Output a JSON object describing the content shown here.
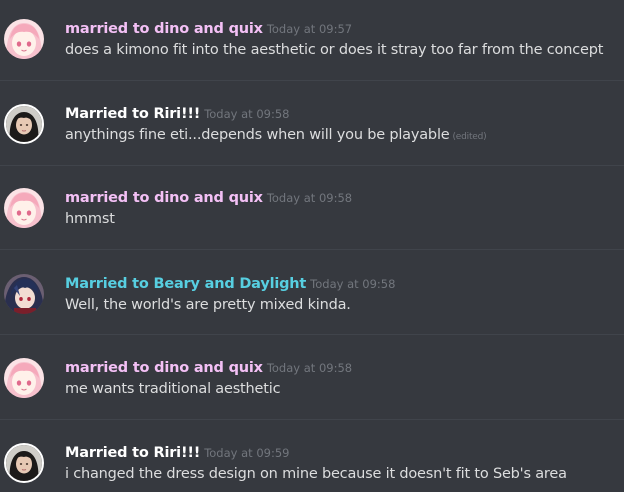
{
  "messages": [
    {
      "username": "married to dino and quix",
      "username_color": "#f3c0f5",
      "timestamp": "Today at 09:57",
      "text": "does a kimono fit into the aesthetic or does it stray too far from the concept",
      "avatar": "pink-hair-avatar"
    },
    {
      "username": "Married to Riri!!!",
      "username_color": "#ffffff",
      "timestamp": "Today at 09:58",
      "text": "anythings fine eti...depends when will you be playable",
      "edited": "(edited)",
      "avatar": "dark-hair-girl-avatar"
    },
    {
      "username": "married to dino and quix",
      "username_color": "#f3c0f5",
      "timestamp": "Today at 09:58",
      "text": "hmmst",
      "avatar": "pink-hair-avatar"
    },
    {
      "username": "Married to Beary and Daylight",
      "username_color": "#57cfe1",
      "timestamp": "Today at 09:58",
      "text": "Well, the world's are pretty mixed kinda.",
      "avatar": "blue-hair-character-avatar"
    },
    {
      "username": "married to dino and quix",
      "username_color": "#f3c0f5",
      "timestamp": "Today at 09:58",
      "text": "me wants traditional aesthetic",
      "avatar": "pink-hair-avatar"
    },
    {
      "username": "Married to Riri!!!",
      "username_color": "#ffffff",
      "timestamp": "Today at 09:59",
      "text": "i changed the dress design on mine because it doesn't fit to Seb's area",
      "avatar": "dark-hair-girl-avatar"
    }
  ]
}
